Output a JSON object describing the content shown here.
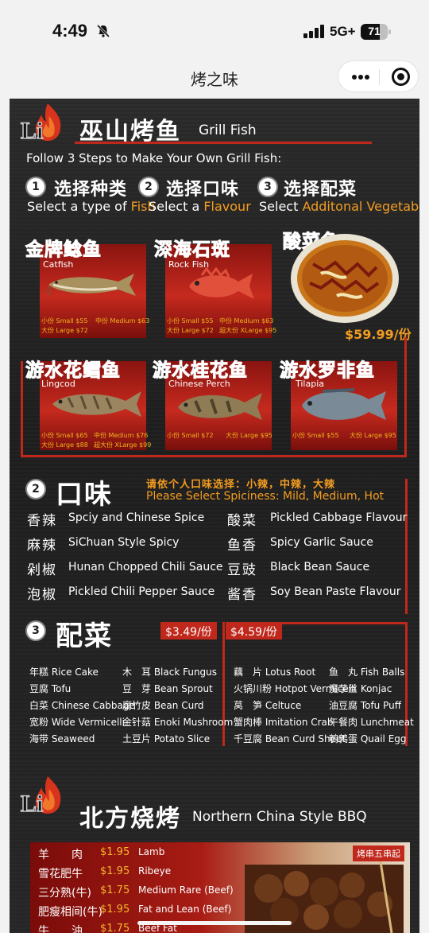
{
  "status_bar": {
    "time": "4:49",
    "network": "5G+",
    "battery": "71",
    "battery_level_pct": 71
  },
  "navbar": {
    "title": "烤之味"
  },
  "header": {
    "logo_text": "Li",
    "title_cn": "巫山烤鱼",
    "title_en": "Grill Fish"
  },
  "intro": "Follow 3 Steps to Make Your Own Grill Fish:",
  "steps": [
    {
      "badge": "1",
      "title": "选择种类",
      "sub_plain": "Select a type of ",
      "sub_hl": "Fish"
    },
    {
      "badge": "2",
      "title": "选择口味",
      "sub_plain": "Select a ",
      "sub_hl": "Flavour"
    },
    {
      "badge": "3",
      "title": "选择配菜",
      "sub_plain": "Select ",
      "sub_hl": "Additonal Vegetable"
    }
  ],
  "fish": [
    {
      "cn": "金牌鲶鱼",
      "en": "Catfish",
      "p1": "小份 Small $55",
      "p2": "中份 Medium $63",
      "p3": "大份 Large $72",
      "p4": ""
    },
    {
      "cn": "深海石斑",
      "en": "Rock Fish",
      "p1": "小份 Small $55",
      "p2": "中份 Medium $63",
      "p3": "大份 Large $72",
      "p4": "超大份 XLarge $95"
    },
    {
      "cn": "酸菜鱼",
      "price": "$59.99/份"
    },
    {
      "cn": "游水花鳕鱼",
      "en": "Lingcod",
      "p1": "小份 Small $65",
      "p2": "中份 Medium $76",
      "p3": "大份 Large $88",
      "p4": "超大份 XLarge $99"
    },
    {
      "cn": "游水桂花鱼",
      "en": "Chinese Perch",
      "p1": "小份 Small $72",
      "p2": "大份 Large $95"
    },
    {
      "cn": "游水罗非鱼",
      "en": "Tilapia",
      "p1": "小份 Small $55",
      "p2": "大份 Large $95"
    }
  ],
  "step2": {
    "badge": "2",
    "title": "口味",
    "spicy_cn": "请依个人口味选择：小辣，中辣，大辣",
    "spicy_en": "Please Select Spiciness: Mild, Medium, Hot",
    "flavours_left": [
      {
        "cn": "香辣",
        "en": "Spciy and Chinese Spice"
      },
      {
        "cn": "麻辣",
        "en": "SiChuan Style Spicy"
      },
      {
        "cn": "剁椒",
        "en": "Hunan Chopped Chili Sauce"
      },
      {
        "cn": "泡椒",
        "en": "Pickled Chili Pepper Sauce"
      }
    ],
    "flavours_right": [
      {
        "cn": "酸菜",
        "en": "Pickled Cabbage Flavour"
      },
      {
        "cn": "鱼香",
        "en": "Spicy Garlic Sauce"
      },
      {
        "cn": "豆豉",
        "en": "Black Bean Sauce"
      },
      {
        "cn": "酱香",
        "en": "Soy Bean Paste Flavour"
      }
    ]
  },
  "step3": {
    "badge": "3",
    "title": "配菜",
    "price_a": "$3.49/份",
    "price_b": "$4.59/份",
    "col1": [
      "年糕 Rice Cake",
      "豆腐 Tofu",
      "白菜 Chinese Cabbage",
      "宽粉 Wide Vermicelli",
      "海带 Seaweed"
    ],
    "col2": [
      "木　耳 Black Fungus",
      "豆　芽 Bean Sprout",
      "腐竹皮 Bean Curd",
      "金针菇 Enoki Mushroom",
      "土豆片 Potato Slice"
    ],
    "col3": [
      "藕　片 Lotus Root",
      "火锅川粉 Hotpot Vermicelli",
      "莴　笋 Celtuce",
      "蟹肉棒 Imitation Crab",
      "千豆腐 Bean Curd Sheet"
    ],
    "col4": [
      "鱼　丸 Fish Balls",
      "魔芋丝 Konjac",
      "油豆腐 Tofu Puff",
      "午餐肉 Lunchmeat",
      "鹌鹑蛋 Quail Egg"
    ]
  },
  "bbq": {
    "logo_text": "Li",
    "title_cn": "北方烧烤",
    "title_en": "Northern China Style BBQ",
    "tag": "烤串五串起",
    "items": [
      {
        "cn": "羊　　肉",
        "price": "$1.95",
        "en": "Lamb"
      },
      {
        "cn": "雪花肥牛",
        "price": "$1.95",
        "en": "Ribeye"
      },
      {
        "cn": "三分熟(牛)",
        "price": "$1.75",
        "en": "Medium Rare (Beef)"
      },
      {
        "cn": "肥瘦相间(牛)",
        "price": "$1.95",
        "en": "Fat and Lean (Beef)"
      },
      {
        "cn": "牛　　油",
        "price": "$1.75",
        "en": "Beef Fat"
      }
    ]
  },
  "colors": {
    "accent_red": "#c0281c",
    "accent_orange": "#f29c20",
    "menu_bg": "#232323"
  }
}
